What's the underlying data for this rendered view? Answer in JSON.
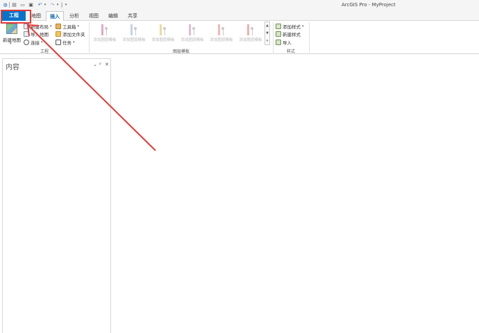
{
  "window": {
    "title": "ArcGIS Pro - MyProject"
  },
  "quick_access": {
    "separator": "|",
    "dropdown": "▾"
  },
  "tabs": [
    {
      "label": "工程"
    },
    {
      "label": "地图"
    },
    {
      "label": "插入"
    },
    {
      "label": "分析"
    },
    {
      "label": "视图"
    },
    {
      "label": "编辑"
    },
    {
      "label": "共享"
    }
  ],
  "ribbon": {
    "project_group": {
      "label": "工程",
      "new_map": "新建地图",
      "new_layout": "新建布局",
      "import_map": "导入地图",
      "connection": "连接",
      "toolbox": "工具箱",
      "add_folder": "添加文件夹",
      "task": "任务"
    },
    "layer_templates": {
      "label": "图层模板",
      "items": [
        {
          "label": "添加图层模板",
          "color": "#e3a8c4"
        },
        {
          "label": "添加图层模板",
          "color": "#c5d3e6"
        },
        {
          "label": "添加图层模板",
          "color": "#e9dca0"
        },
        {
          "label": "添加图层模板",
          "color": "#e0bcd0"
        },
        {
          "label": "添加图层模板",
          "color": "#f2b8b8"
        },
        {
          "label": "添加图层模板",
          "color": "#f0b0b0"
        }
      ]
    },
    "styles_group": {
      "label": "样式",
      "add_style": "添加样式",
      "new_style": "新建样式",
      "import": "导入"
    }
  },
  "contents_pane": {
    "title": "内容",
    "controls": {
      "menu": "⌄",
      "pin": "ᵖ",
      "close": "✕"
    }
  },
  "colors": {
    "accent": "#0a73c9",
    "annotation": "#e53935"
  }
}
